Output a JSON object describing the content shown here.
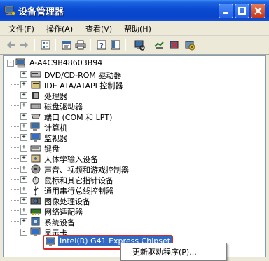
{
  "window": {
    "title": "设备管理器"
  },
  "menubar": {
    "items": [
      "文件(F)",
      "操作(A)",
      "查看(V)",
      "帮助(H)"
    ]
  },
  "tree": {
    "root": "A-A4C9B48603B94",
    "categories": [
      {
        "label": "DVD/CD-ROM 驱动器",
        "icon": "dvd-drive-icon",
        "expander": "+"
      },
      {
        "label": "IDE ATA/ATAPI 控制器",
        "icon": "ide-controller-icon",
        "expander": "+"
      },
      {
        "label": "处理器",
        "icon": "processor-icon",
        "expander": "+"
      },
      {
        "label": "磁盘驱动器",
        "icon": "disk-drive-icon",
        "expander": "+"
      },
      {
        "label": "端口 (COM 和 LPT)",
        "icon": "port-icon",
        "expander": "+"
      },
      {
        "label": "计算机",
        "icon": "computer-icon",
        "expander": "+"
      },
      {
        "label": "监视器",
        "icon": "monitor-icon",
        "expander": "+"
      },
      {
        "label": "键盘",
        "icon": "keyboard-icon",
        "expander": "+"
      },
      {
        "label": "人体学输入设备",
        "icon": "hid-icon",
        "expander": "+"
      },
      {
        "label": "声音、视频和游戏控制器",
        "icon": "sound-icon",
        "expander": "+"
      },
      {
        "label": "鼠标和其它指针设备",
        "icon": "mouse-icon",
        "expander": "+"
      },
      {
        "label": "通用串行总线控制器",
        "icon": "usb-icon",
        "expander": "+"
      },
      {
        "label": "图像处理设备",
        "icon": "imaging-icon",
        "expander": "+"
      },
      {
        "label": "网络适配器",
        "icon": "network-adapter-icon",
        "expander": "+"
      },
      {
        "label": "系统设备",
        "icon": "system-device-icon",
        "expander": "+"
      },
      {
        "label": "显示卡",
        "icon": "display-adapter-icon",
        "expander": "-"
      }
    ],
    "selected_device": "Intel(R) G41 Express Chipset"
  },
  "context_menu": {
    "items": [
      "更新驱动程序(P)..."
    ]
  },
  "colors": {
    "titlebar": "#0a4bd1",
    "selection": "#316ac5",
    "highlight_border": "#d82a2a"
  }
}
